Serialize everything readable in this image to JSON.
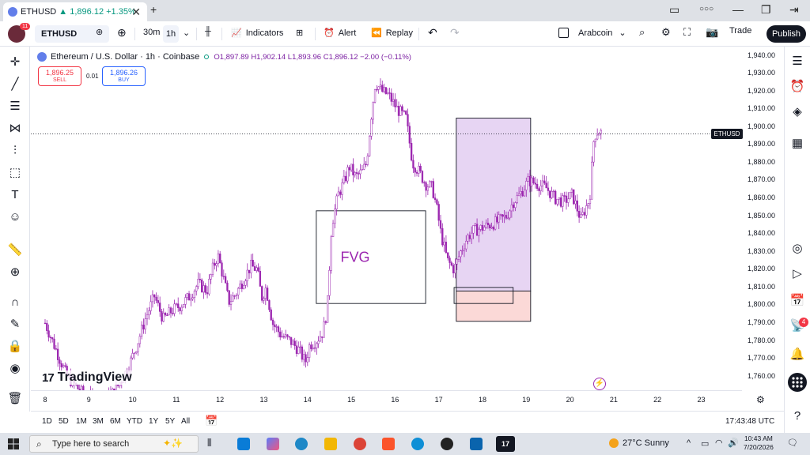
{
  "browser": {
    "tab_symbol": "ETHUSD",
    "tab_change": "▲ 1,896.12 +1.35%",
    "tab_close": "✕",
    "new_tab": "+"
  },
  "toolbar": {
    "symbol": "ETHUSD",
    "tf_30m": "30m",
    "tf_1h": "1h",
    "indicators": "Indicators",
    "alert": "Alert",
    "replay": "Replay",
    "layout_name": "Arabcoin",
    "trade": "Trade",
    "publish": "Publish",
    "avatar_badge": "11"
  },
  "legend": {
    "title": "Ethereum / U.S. Dollar · 1h · Coinbase",
    "ohlc": "O1,897.89 H1,902.14 L1,893.96 C1,896.12 −2.00 (−0.11%)"
  },
  "quote": {
    "sell_price": "1,896.25",
    "sell_label": "SELL",
    "spread": "0.01",
    "buy_price": "1,896.26",
    "buy_label": "BUY"
  },
  "annotation": {
    "fvg_label": "FVG"
  },
  "price_label": "ETHUSD",
  "watermark": "TradingView",
  "range": {
    "r1d": "1D",
    "r5d": "5D",
    "r1m": "1M",
    "r3m": "3M",
    "r6m": "6M",
    "ytd": "YTD",
    "r1y": "1Y",
    "r5y": "5Y",
    "all": "All"
  },
  "clock": "17:43:48 UTC",
  "taskbar": {
    "search_placeholder": "Type here to search",
    "weather": "27°C  Sunny",
    "time": "10:43 AM",
    "date": "7/20/2026"
  },
  "right_badge": "4",
  "colors": {
    "candle": "#9c27b0",
    "up": "#089981",
    "down": "#f23645",
    "box_purple": "#e7d5f3",
    "box_red": "#fbd9d7"
  },
  "chart_data": {
    "type": "candlestick",
    "x_ticks": [
      "8",
      "9",
      "10",
      "11",
      "12",
      "13",
      "14",
      "15",
      "16",
      "17",
      "18",
      "19",
      "20",
      "21",
      "22",
      "23"
    ],
    "y_ticks": [
      "1,940.00",
      "1,930.00",
      "1,920.00",
      "1,910.00",
      "1,900.00",
      "1,890.00",
      "1,880.00",
      "1,870.00",
      "1,860.00",
      "1,850.00",
      "1,840.00",
      "1,830.00",
      "1,820.00",
      "1,810.00",
      "1,800.00",
      "1,790.00",
      "1,780.00",
      "1,770.00",
      "1,760.00"
    ],
    "ylim": [
      1755,
      1942
    ],
    "current_price": 1896.12,
    "close_path": [
      [
        8.0,
        1790
      ],
      [
        8.3,
        1772
      ],
      [
        8.5,
        1760
      ],
      [
        8.8,
        1752
      ],
      [
        9.0,
        1748
      ],
      [
        9.3,
        1746
      ],
      [
        9.6,
        1752
      ],
      [
        9.9,
        1765
      ],
      [
        10.1,
        1778
      ],
      [
        10.3,
        1793
      ],
      [
        10.5,
        1805
      ],
      [
        10.7,
        1792
      ],
      [
        10.9,
        1797
      ],
      [
        11.1,
        1800
      ],
      [
        11.3,
        1805
      ],
      [
        11.5,
        1812
      ],
      [
        11.7,
        1808
      ],
      [
        11.85,
        1822
      ],
      [
        11.95,
        1828
      ],
      [
        12.05,
        1818
      ],
      [
        12.2,
        1802
      ],
      [
        12.35,
        1806
      ],
      [
        12.55,
        1815
      ],
      [
        12.7,
        1822
      ],
      [
        12.85,
        1820
      ],
      [
        12.95,
        1804
      ],
      [
        13.05,
        1810
      ],
      [
        13.2,
        1790
      ],
      [
        13.4,
        1783
      ],
      [
        13.6,
        1780
      ],
      [
        13.8,
        1775
      ],
      [
        13.95,
        1768
      ],
      [
        14.05,
        1778
      ],
      [
        14.2,
        1780
      ],
      [
        14.35,
        1785
      ],
      [
        14.45,
        1798
      ],
      [
        14.55,
        1845
      ],
      [
        14.7,
        1862
      ],
      [
        14.85,
        1870
      ],
      [
        14.95,
        1878
      ],
      [
        15.1,
        1872
      ],
      [
        15.25,
        1875
      ],
      [
        15.35,
        1880
      ],
      [
        15.45,
        1905
      ],
      [
        15.55,
        1925
      ],
      [
        15.7,
        1920
      ],
      [
        15.85,
        1918
      ],
      [
        16.05,
        1910
      ],
      [
        16.25,
        1905
      ],
      [
        16.4,
        1880
      ],
      [
        16.55,
        1875
      ],
      [
        16.7,
        1868
      ],
      [
        16.85,
        1866
      ],
      [
        16.95,
        1855
      ],
      [
        17.05,
        1840
      ],
      [
        17.2,
        1825
      ],
      [
        17.35,
        1820
      ],
      [
        17.5,
        1830
      ],
      [
        17.65,
        1838
      ],
      [
        17.8,
        1842
      ],
      [
        17.95,
        1843
      ],
      [
        18.15,
        1845
      ],
      [
        18.35,
        1847
      ],
      [
        18.55,
        1850
      ],
      [
        18.7,
        1858
      ],
      [
        18.85,
        1862
      ],
      [
        19.05,
        1870
      ],
      [
        19.25,
        1868
      ],
      [
        19.45,
        1866
      ],
      [
        19.65,
        1860
      ],
      [
        19.85,
        1858
      ],
      [
        20.05,
        1862
      ],
      [
        20.25,
        1848
      ],
      [
        20.45,
        1860
      ],
      [
        20.55,
        1895
      ],
      [
        20.65,
        1898
      ],
      [
        20.75,
        1896
      ]
    ],
    "annotations": [
      {
        "type": "rectangle",
        "label": "FVG",
        "x": [
          14.2,
          16.7
        ],
        "y": [
          1801,
          1853
        ]
      },
      {
        "type": "rectangle",
        "x": [
          17.35,
          18.7
        ],
        "y": [
          1801,
          1810
        ]
      },
      {
        "type": "long_position",
        "x": [
          17.4,
          19.1
        ],
        "profit": [
          1808,
          1905
        ],
        "stop": [
          1791,
          1808
        ]
      }
    ]
  }
}
